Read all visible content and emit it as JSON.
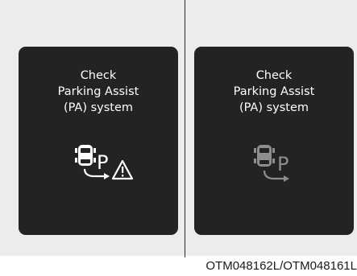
{
  "left_panel": {
    "message": [
      "Check",
      "Parking Assist",
      "(PA) system"
    ],
    "icon_letter": "P",
    "icon_state": "warning",
    "icon_color": "#ffffff"
  },
  "right_panel": {
    "message": [
      "Check",
      "Parking Assist",
      "(PA) system"
    ],
    "icon_letter": "P",
    "icon_state": "inactive",
    "icon_color": "#8e8e8e"
  },
  "caption": "OTM048162L/OTM048161L"
}
